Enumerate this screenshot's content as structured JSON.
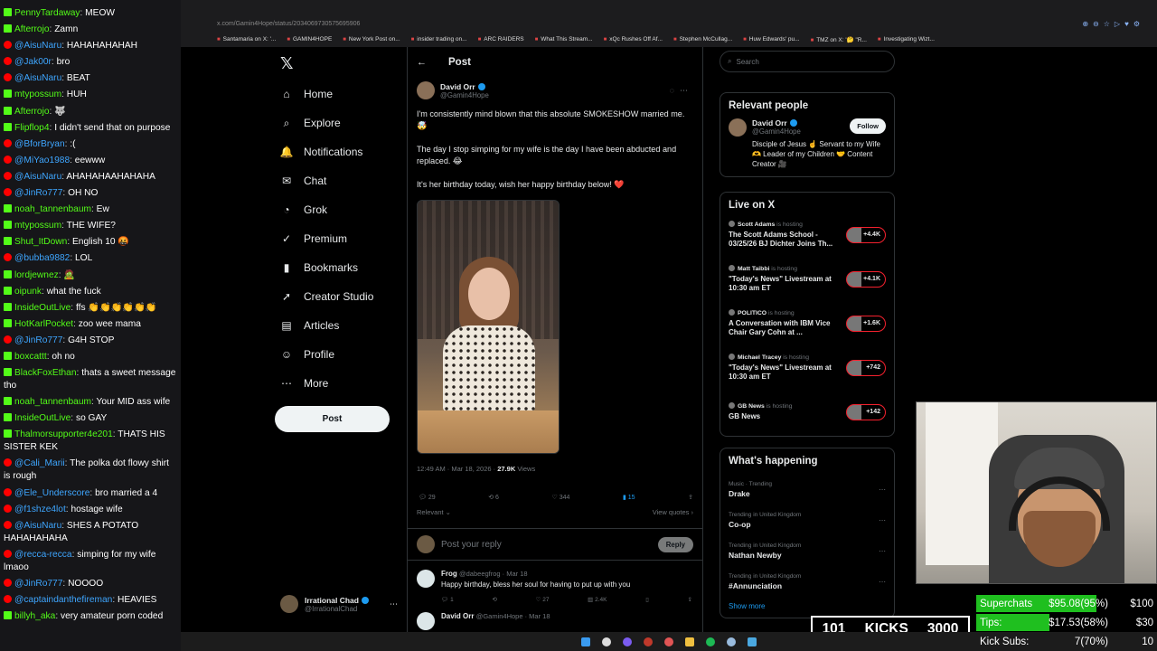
{
  "chat": [
    {
      "user": "PennyTardaway",
      "platform": "kick",
      "text": "MEOW"
    },
    {
      "user": "Afterrojo",
      "platform": "kick",
      "text": "Zamn"
    },
    {
      "user": "@AisuNaru",
      "platform": "youtube",
      "text": "HAHAHAHAHAH"
    },
    {
      "user": "@Jak00r",
      "platform": "youtube",
      "text": "bro"
    },
    {
      "user": "@AisuNaru",
      "platform": "youtube",
      "text": "BEAT"
    },
    {
      "user": "mtypossum",
      "platform": "kick",
      "text": "HUH"
    },
    {
      "user": "Afterrojo",
      "platform": "kick",
      "text": "🐺"
    },
    {
      "user": "Flipflop4",
      "platform": "kick",
      "text": "I didn't send that on purpose"
    },
    {
      "user": "@BforBryan",
      "platform": "youtube",
      "text": ":("
    },
    {
      "user": "@MiYao1988",
      "platform": "youtube",
      "text": "eewww"
    },
    {
      "user": "@AisuNaru",
      "platform": "youtube",
      "text": "AHAHAHAAHAHAHA"
    },
    {
      "user": "@JinRo777",
      "platform": "youtube",
      "text": "OH NO"
    },
    {
      "user": "noah_tannenbaum",
      "platform": "kick",
      "text": "Ew"
    },
    {
      "user": "mtypossum",
      "platform": "kick",
      "text": "THE WIFE?"
    },
    {
      "user": "Shut_ItDown",
      "platform": "kick",
      "text": "English 10 🤬"
    },
    {
      "user": "@bubba9882",
      "platform": "youtube",
      "text": "LOL"
    },
    {
      "user": "lordjewnez",
      "platform": "kick",
      "text": "🧟"
    },
    {
      "user": "oipunk",
      "platform": "kick",
      "text": "what the fuck"
    },
    {
      "user": "InsideOutLive",
      "platform": "kick",
      "text": "ffs 👏👏👏👏👏👏"
    },
    {
      "user": "HotKarlPocket",
      "platform": "kick",
      "text": "zoo wee mama"
    },
    {
      "user": "@JinRo777",
      "platform": "youtube",
      "text": "G4H STOP"
    },
    {
      "user": "boxcattt",
      "platform": "kick",
      "text": "oh no"
    },
    {
      "user": "BlackFoxEthan",
      "platform": "kick",
      "text": "thats a sweet message tho"
    },
    {
      "user": "noah_tannenbaum",
      "platform": "kick",
      "text": "Your MID ass wife"
    },
    {
      "user": "InsideOutLive",
      "platform": "kick",
      "text": "so GAY"
    },
    {
      "user": "Thalmorsupporter4e201",
      "platform": "kick",
      "text": "THATS HIS SISTER KEK"
    },
    {
      "user": "@Cali_Marii",
      "platform": "youtube",
      "text": "The polka dot flowy shirt is rough"
    },
    {
      "user": "@Ele_Underscore",
      "platform": "youtube",
      "text": "bro married a 4"
    },
    {
      "user": "@f1shze4lot",
      "platform": "youtube",
      "text": "hostage wife"
    },
    {
      "user": "@AisuNaru",
      "platform": "youtube",
      "text": "SHES A POTATO HAHAHAHAHA"
    },
    {
      "user": "@recca-recca",
      "platform": "youtube",
      "text": "simping for my wife lmaoo"
    },
    {
      "user": "@JinRo777",
      "platform": "youtube",
      "text": "NOOOO"
    },
    {
      "user": "@captaindanthefireman",
      "platform": "youtube",
      "text": "HEAVIES"
    },
    {
      "user": "billyh_aka",
      "platform": "kick",
      "text": "very amateur porn coded"
    }
  ],
  "browser": {
    "address": "x.com/Gamin4Hope/status/2034069730575695906",
    "bookmarks": [
      "Santamaria on X: '...",
      "GAMIN4HOPE",
      "New York Post on...",
      "insider trading on...",
      "ARC RAIDERS",
      "What This Stream...",
      "xQc Rushes Off Af...",
      "Stephen McCullag...",
      "Huw Edwards' pu...",
      "TMZ on X: '🤔 \"R...",
      "Investigating Wizt..."
    ]
  },
  "nav": {
    "items": [
      {
        "label": "Home",
        "icon": "⌂"
      },
      {
        "label": "Explore",
        "icon": "⌕"
      },
      {
        "label": "Notifications",
        "icon": "🔔"
      },
      {
        "label": "Chat",
        "icon": "✉"
      },
      {
        "label": "Grok",
        "icon": "◔"
      },
      {
        "label": "Premium",
        "icon": "✓"
      },
      {
        "label": "Bookmarks",
        "icon": "▮"
      },
      {
        "label": "Creator Studio",
        "icon": "➚"
      },
      {
        "label": "Articles",
        "icon": "▤"
      },
      {
        "label": "Profile",
        "icon": "☺"
      },
      {
        "label": "More",
        "icon": "⋯"
      }
    ],
    "post_label": "Post",
    "account_name": "Irrational Chad",
    "account_handle": "@IrrationalChad"
  },
  "post": {
    "header": "Post",
    "author_name": "David Orr",
    "author_handle": "@Gamin4Hope",
    "text1": "I'm consistently mind blown that this absolute SMOKESHOW married me. 🤯",
    "text2": "The day I stop simping for my wife is the day I have been abducted and replaced. 😂",
    "text3": "It's her birthday today, wish her happy birthday below! ❤️",
    "time": "12:49 AM · Mar 18, 2026 · ",
    "views": "27.9K",
    "views_label": " Views",
    "replies": "29",
    "reposts": "6",
    "likes": "344",
    "bookmarks": "15",
    "relevant": "Relevant ⌄",
    "view_quotes": "View quotes ›",
    "reply_placeholder": "Post your reply",
    "reply_button": "Reply"
  },
  "replies": [
    {
      "name": "Frog",
      "handle": "@dabeegfrog · Mar 18",
      "text": "Happy birthday, bless her soul for having to put up with you",
      "r": "1",
      "rt": "",
      "l": "27",
      "v": "2.4K"
    },
    {
      "name": "David Orr",
      "handle": "@Gamin4Hope · Mar 18",
      "text": "",
      "r": "",
      "rt": "",
      "l": "",
      "v": ""
    }
  ],
  "right": {
    "search_placeholder": "Search",
    "relevant_title": "Relevant people",
    "rp_name": "David Orr",
    "rp_handle": "@Gamin4Hope",
    "rp_follow": "Follow",
    "rp_bio": "Disciple of Jesus ☝️ Servant to my Wife 🫶 Leader of my Children 🤝 Content Creator 🎥",
    "live_title": "Live on X",
    "live": [
      {
        "host": "Scott Adams",
        "tag": " is hosting",
        "title": "The Scott Adams School - 03/25/26 BJ Dichter Joins Th...",
        "count": "+4.4K"
      },
      {
        "host": "Matt Taibbi",
        "tag": " is hosting",
        "title": "\"Today's News\" Livestream at 10:30 am ET",
        "count": "+4.1K"
      },
      {
        "host": "POLITICO",
        "tag": " is hosting",
        "title": "A Conversation with IBM Vice Chair Gary Cohn at ...",
        "count": "+1.6K"
      },
      {
        "host": "Michael Tracey",
        "tag": " is hosting",
        "title": "\"Today's News\" Livestream at 10:30 am ET",
        "count": "+742"
      },
      {
        "host": "GB News",
        "tag": " is hosting",
        "title": "GB News",
        "count": "+142"
      }
    ],
    "trends_title": "What's happening",
    "trends": [
      {
        "ctx": "Music · Trending",
        "name": "Drake"
      },
      {
        "ctx": "Trending in United Kingdom",
        "name": "Co-op"
      },
      {
        "ctx": "Trending in United Kingdom",
        "name": "Nathan Newby"
      },
      {
        "ctx": "Trending in United Kingdom",
        "name": "#Annunciation"
      }
    ],
    "show_more": "Show more"
  },
  "overlay": {
    "kicks_current": "101",
    "kicks_label": "KICKS",
    "kicks_goal": "3000",
    "stats": [
      {
        "label": "Superchats",
        "value": "$95.08(95%)",
        "goal": "$100",
        "progress": 0.95
      },
      {
        "label": "Tips:",
        "value": "$17.53(58%)",
        "goal": "$30",
        "progress": 0.58
      },
      {
        "label": "Kick Subs:",
        "value": "7(70%)",
        "goal": "10",
        "progress": 0.7
      }
    ]
  },
  "colors": {
    "accent": "#1d9bf0",
    "kick": "#53fc18",
    "youtube": "#ff0000",
    "live": "#f4212e"
  }
}
